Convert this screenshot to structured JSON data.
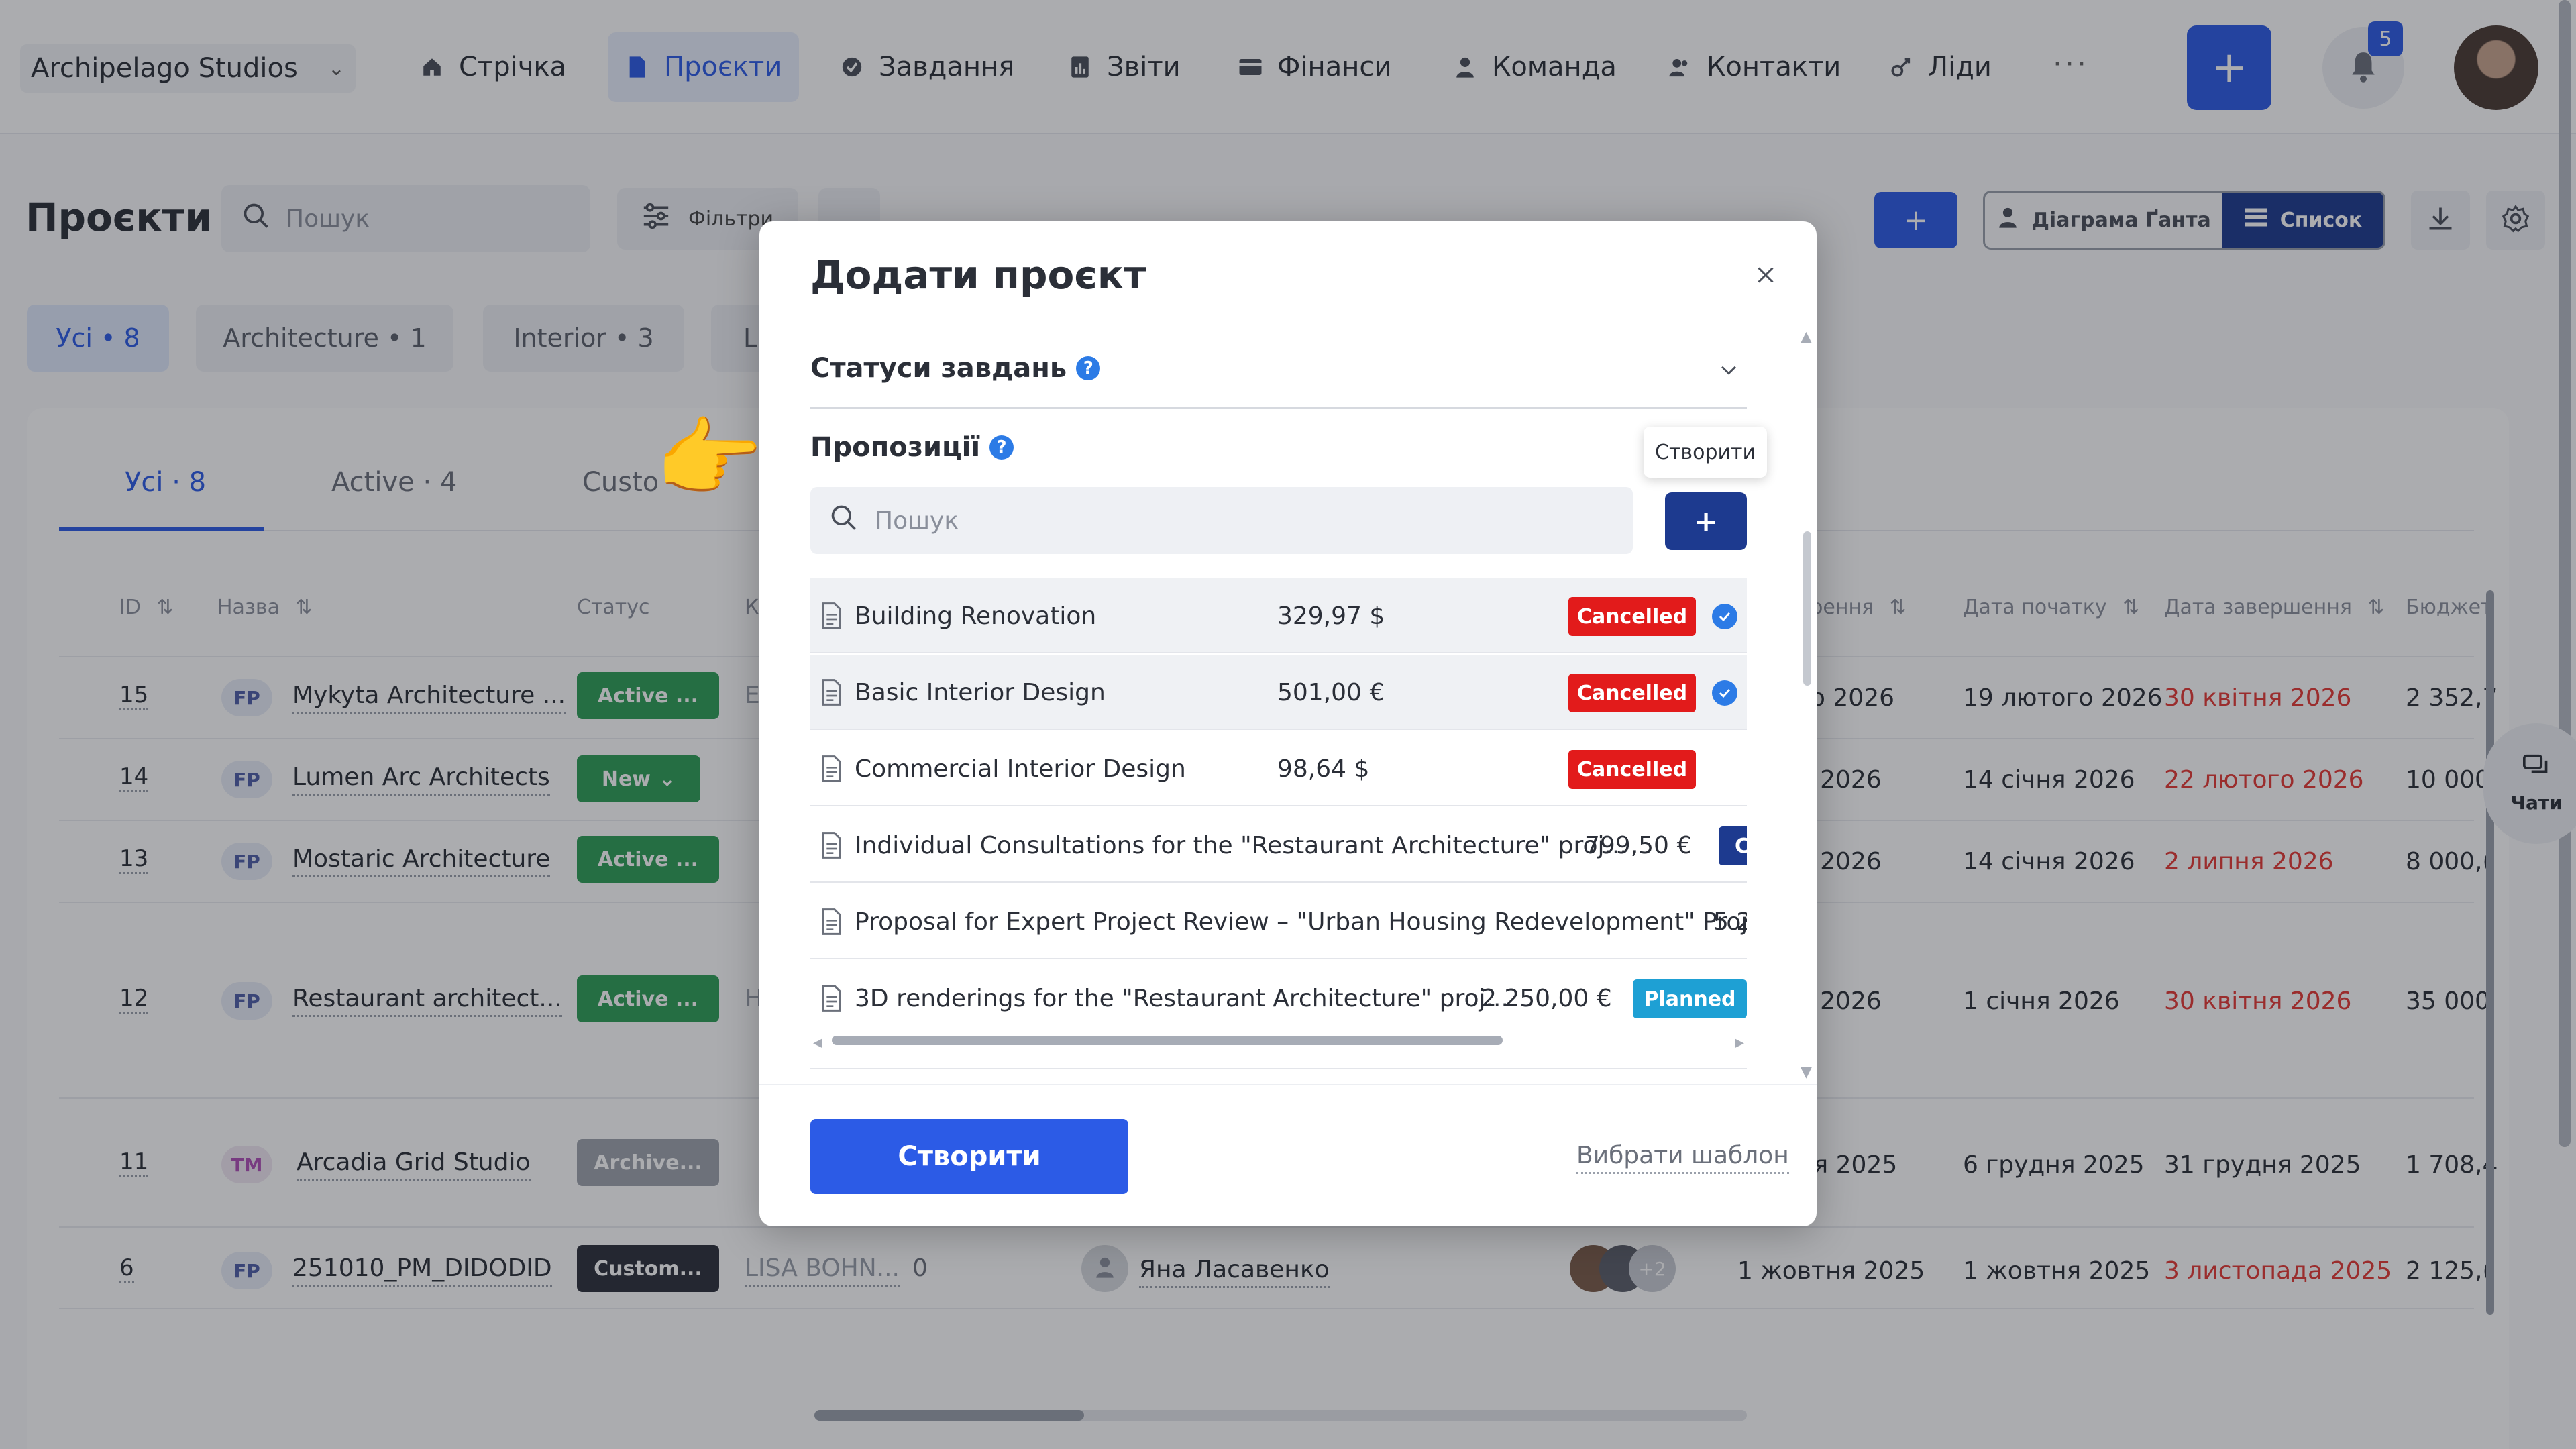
{
  "workspace": {
    "name": "Archipelago Studios"
  },
  "nav": {
    "items": [
      {
        "label": "Стрічка",
        "icon": "home-icon"
      },
      {
        "label": "Проєкти",
        "icon": "document-icon"
      },
      {
        "label": "Завдання",
        "icon": "check-circle-icon"
      },
      {
        "label": "Звіти",
        "icon": "report-icon"
      },
      {
        "label": "Фінанси",
        "icon": "wallet-icon"
      },
      {
        "label": "Команда",
        "icon": "person-icon"
      },
      {
        "label": "Контакти",
        "icon": "contacts-icon"
      },
      {
        "label": "Ліди",
        "icon": "leads-icon"
      }
    ],
    "more": "···",
    "add": "+",
    "notifications_count": "5"
  },
  "page": {
    "title": "Проєкти",
    "search_placeholder": "Пошук",
    "filters_label": "Фільтри",
    "add": "+",
    "views": {
      "gantt": "Діаграма Ґанта",
      "list": "Список"
    }
  },
  "categories": [
    "Усі • 8",
    "Architecture • 1",
    "Interior • 3",
    "L"
  ],
  "tabs": [
    "Усі · 8",
    "Active · 4",
    "Custo"
  ],
  "table": {
    "headers": {
      "id": "ID",
      "name": "Назва",
      "status": "Статус",
      "k": "К",
      "created": "орення",
      "start": "Дата початку",
      "end": "Дата завершення",
      "budget": "Бюджет"
    },
    "rows": [
      {
        "id": "15",
        "badge": "FP",
        "name": "Mykyta Architecture ...",
        "status": "Active ...",
        "col": "E",
        "created": "го 2026",
        "start": "19 лютого 2026",
        "end": "30 квітня 2026",
        "budget": "2 352,7"
      },
      {
        "id": "14",
        "badge": "FP",
        "name": "Lumen Arc Architects",
        "status": "New",
        "col": "",
        "created": "я 2026",
        "start": "14 січня 2026",
        "end": "22 лютого 2026",
        "budget": "10 000"
      },
      {
        "id": "13",
        "badge": "FP",
        "name": "Mostaric Architecture",
        "status": "Active ...",
        "col": "",
        "created": "я 2026",
        "start": "14 січня 2026",
        "end": "2 липня 2026",
        "budget": "8 000,("
      },
      {
        "id": "12",
        "badge": "FP",
        "name": "Restaurant architect...",
        "status": "Active ...",
        "col": "H",
        "created": "я 2026",
        "start": "1 січня 2026",
        "end": "30 квітня 2026",
        "budget": "35 000"
      },
      {
        "id": "11",
        "badge": "TM",
        "name": "Arcadia Grid Studio",
        "status": "Archive...",
        "col": "",
        "created": "ня 2025",
        "start": "6 грудня 2025",
        "end": "31 грудня 2025",
        "budget": "1 708,4"
      },
      {
        "id": "6",
        "badge": "FP",
        "name": "251010_PM_DIDODID",
        "status": "Custom...",
        "col": "LISA BOHN...",
        "zero": "0",
        "owner": "Яна Ласавенко",
        "more_avatars": "+2",
        "created": "1 жовтня 2025",
        "start": "1 жовтня 2025",
        "end": "3 листопада 2025",
        "budget": "2 125,("
      }
    ]
  },
  "chat": {
    "label": "Чати"
  },
  "modal": {
    "title": "Додати проєкт",
    "section_statuses": "Статуси завдань",
    "section_proposals": "Пропозиції",
    "help": "?",
    "tooltip": "Створити",
    "search_placeholder": "Пошук",
    "add": "+",
    "proposals": [
      {
        "name": "Building Renovation",
        "price": "329,97 $",
        "status": "Cancelled",
        "checked": true
      },
      {
        "name": "Basic Interior Design",
        "price": "501,00 €",
        "status": "Cancelled",
        "checked": true
      },
      {
        "name": "Commercial Interior Design",
        "price": "98,64 $",
        "status": "Cancelled",
        "checked": false
      },
      {
        "name": "Individual Consultations for the \"Restaurant Architecture\" proj...",
        "price": "799,50 €",
        "status": "C",
        "checked": false
      },
      {
        "name": "Proposal for Expert Project Review – \"Urban Housing Redevelopment\" Proj...",
        "price": "5 2",
        "status": "",
        "checked": false
      },
      {
        "name": "3D renderings for the \"Restaurant Architecture\" proj...",
        "price": "2 250,00 €",
        "status": "Planned",
        "checked": false
      }
    ],
    "create_button": "Створити",
    "template_link": "Вибрати шаблон"
  },
  "colors": {
    "accent": "#2c5be6",
    "navy": "#1d3a8f",
    "cancelled": "#e21b1b",
    "planned": "#1ea0d4",
    "active": "#2e9e57",
    "deadline": "#e53935"
  }
}
